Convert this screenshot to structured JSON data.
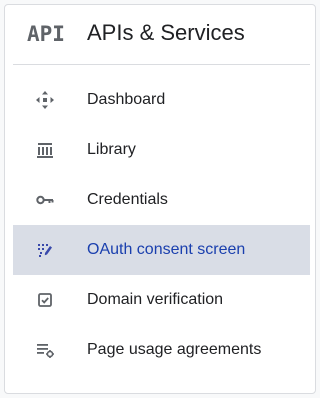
{
  "header": {
    "logo_text": "API",
    "title": "APIs & Services"
  },
  "nav": {
    "items": [
      {
        "label": "Dashboard",
        "icon": "dashboard-icon",
        "active": false
      },
      {
        "label": "Library",
        "icon": "library-icon",
        "active": false
      },
      {
        "label": "Credentials",
        "icon": "key-icon",
        "active": false
      },
      {
        "label": "OAuth consent screen",
        "icon": "oauth-consent-icon",
        "active": true
      },
      {
        "label": "Domain verification",
        "icon": "checkbox-icon",
        "active": false
      },
      {
        "label": "Page usage agreements",
        "icon": "settings-list-icon",
        "active": false
      }
    ]
  },
  "colors": {
    "active_background": "#d9dde6",
    "active_text": "#1a3fae",
    "icon": "#5f6368",
    "active_icon": "#3949ab"
  }
}
